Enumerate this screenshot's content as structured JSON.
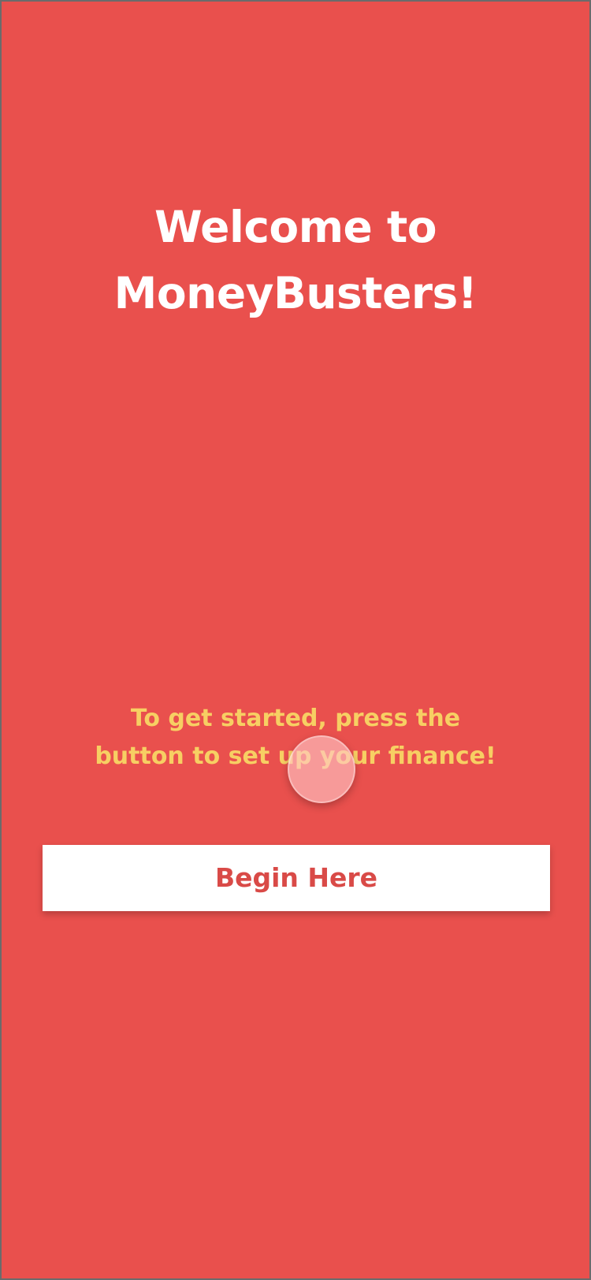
{
  "welcome": {
    "title_line1": "Welcome to",
    "title_line2": "MoneyBusters!"
  },
  "instructions": {
    "line1": "To get started, press the",
    "line2": "button to set up your finance!"
  },
  "actions": {
    "begin_label": "Begin Here"
  },
  "colors": {
    "background": "#e9504d",
    "title_text": "#ffffff",
    "instruction_text": "#f7cf63",
    "button_background": "#ffffff",
    "button_text": "#d94a47"
  }
}
